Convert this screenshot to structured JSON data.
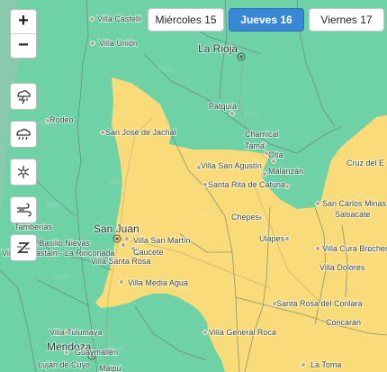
{
  "day_tabs": [
    {
      "label": "Miércoles 15",
      "active": false
    },
    {
      "label": "Jueves 16",
      "active": true
    },
    {
      "label": "Viernes 17",
      "active": false
    }
  ],
  "zoom": {
    "in": "+",
    "out": "−"
  },
  "tools": [
    "storm-icon",
    "rain-icon",
    "snow-icon",
    "wind-icon",
    "zonda-icon"
  ],
  "colors": {
    "green_zone": "#6fd1a6",
    "yellow_zone": "#fadb79",
    "active_tab": "#3a87d8"
  },
  "places": {
    "villa_castelli": "Villa Castelli",
    "villa_union": "Villa Unión",
    "la_rioja": "La Rioja",
    "patquia": "Patquía",
    "rodeo": "Rodeo",
    "san_jose_de_jachal": "San José de Jachal",
    "chamical": "Chamical",
    "tama": "Tama",
    "olta": "Olta",
    "cruz_del_eje": "Cruz del E",
    "villa_san_agustin": "Villa San Agustín",
    "malanzan": "Malanzán",
    "santa_rita_de_catuna": "Santa Rita de Catuna",
    "san_carlos_minas": "San Carlos Minas",
    "salsacate": "Salsacate",
    "chepes": "Chepes",
    "ulapes": "Ulapes",
    "villa_cura_brochero": "Villa Cura Brochero",
    "villa_dolores": "Villa Dolores",
    "tamberias": "Tamberías",
    "san_juan": "San Juan",
    "villa_basilio_nievas": "Villa Basilio Nievas",
    "villa_aberastain": "Villa Aberastain - La Rinconada",
    "villa_san_martin": "Villa San Martín",
    "caucete": "Caucete",
    "villa_santa_rosa": "Villa Santa Rosa",
    "villa_media_agua": "Villa Media Agua",
    "santa_rosa_del_conlara": "Santa Rosa del Conlara",
    "concaran": "Concarán",
    "villa_tulumaya": "Villa Tulumaya",
    "mendoza": "Mendoza",
    "guaymallen": "Guaymallén",
    "lujan_de_cuyo": "Luján de Cuyo",
    "maipu": "Maipú",
    "villa_general_roca": "Villa General Roca",
    "la_toma": "La Toma"
  }
}
